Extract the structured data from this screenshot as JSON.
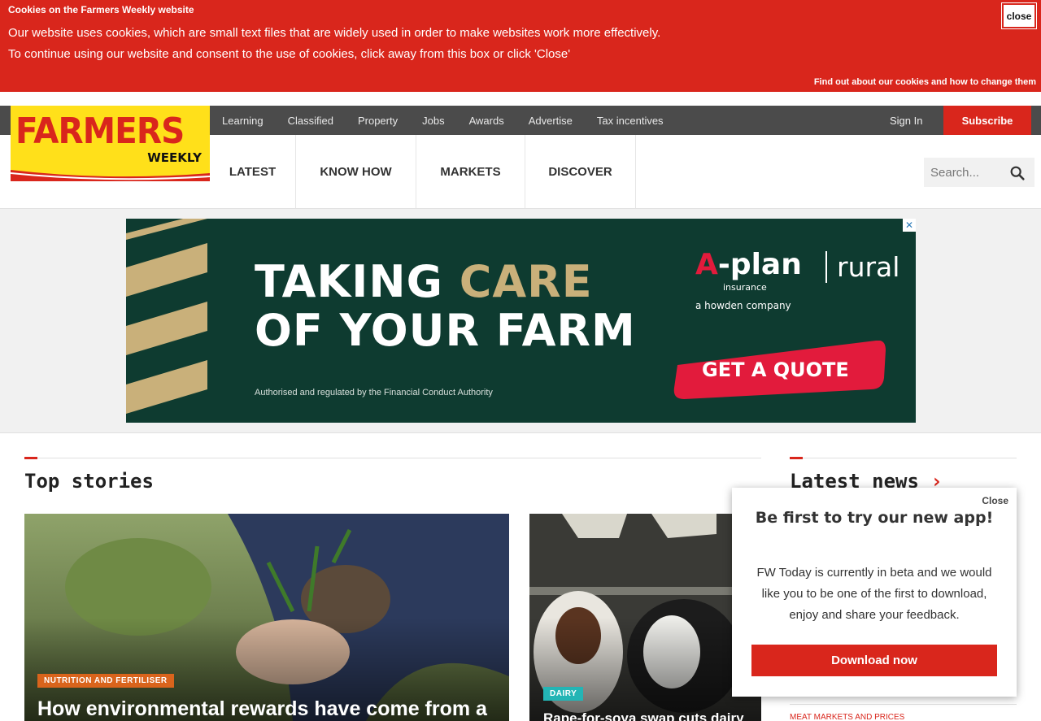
{
  "cookie_banner": {
    "title": "Cookies on the Farmers Weekly website",
    "line1": "Our website uses cookies, which are small text files that are widely used in order to make websites work more effectively.",
    "line2": "To continue using our website and consent to the use of cookies, click away from this box or click 'Close'",
    "close_label": "close",
    "link": "Find out about our cookies and how to change them"
  },
  "logo": {
    "word": "FARMERS",
    "sub": "WEEKLY"
  },
  "utility_nav": [
    "Learning",
    "Classified",
    "Property",
    "Jobs",
    "Awards",
    "Advertise",
    "Tax incentives"
  ],
  "account": {
    "signin": "Sign In",
    "subscribe": "Subscribe"
  },
  "main_nav": [
    "LATEST",
    "KNOW HOW",
    "MARKETS",
    "DISCOVER"
  ],
  "search": {
    "placeholder": "Search..."
  },
  "ad": {
    "line1a": "TAKING ",
    "line1b": "CARE",
    "line2": "OF YOUR FARM",
    "disclaimer": "Authorised and regulated by the Financial Conduct Authority",
    "brand_main": "A-plan",
    "brand_first": "A",
    "brand_rest": "-plan",
    "brand_rural": "rural",
    "brand_insurance": "insurance",
    "brand_howden": "a howden company",
    "cta": "GET A QUOTE",
    "close": "✕"
  },
  "top_stories": {
    "title": "Top stories",
    "stories": [
      {
        "tag": "NUTRITION AND FERTILISER",
        "headline": "How environmental rewards have come from a"
      },
      {
        "tag": "DAIRY",
        "headline": "Rape-for-soya swap cuts dairy"
      }
    ]
  },
  "latest_news": {
    "title": "Latest news",
    "chevron": "›",
    "first_category": "MEAT MARKETS AND PRICES"
  },
  "popup": {
    "close": "Close",
    "title": "Be first to try our new app!",
    "body": "FW Today is currently in beta and we would like you to be one of the first to download, enjoy and share your feedback.",
    "button": "Download now"
  },
  "colors": {
    "brand_red": "#d9261c",
    "logo_yellow": "#ffe01a",
    "ad_green": "#0e3b30",
    "utility_bar": "#4b4b4b"
  }
}
